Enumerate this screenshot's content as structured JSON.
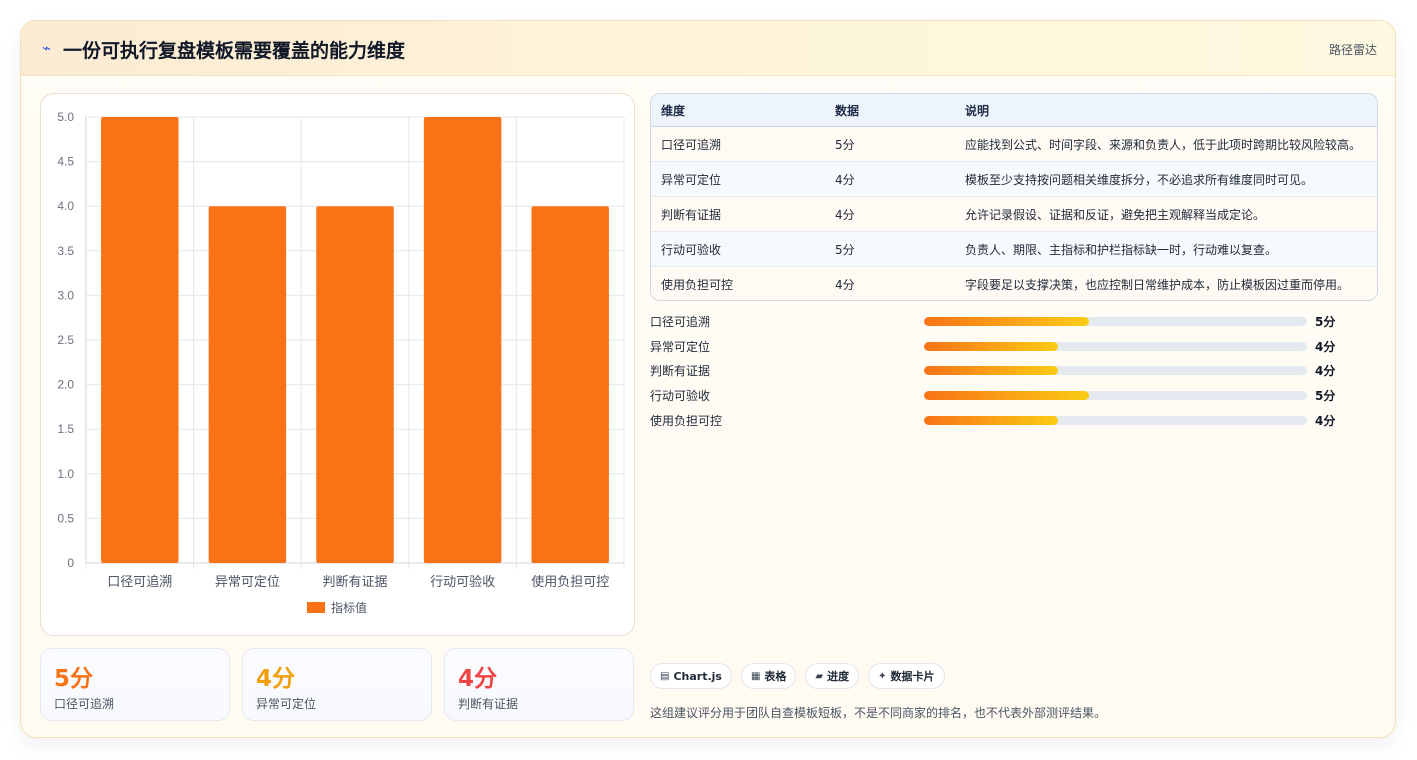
{
  "header": {
    "icon": "lightning-icon",
    "icon_glyph": "⌁",
    "title": "一份可执行复盘模板需要覆盖的能力维度",
    "tag": "路径雷达"
  },
  "chart_data": {
    "type": "bar",
    "categories": [
      "口径可追溯",
      "异常可定位",
      "判断有证据",
      "行动可验收",
      "使用负担可控"
    ],
    "series": [
      {
        "name": "指标值",
        "values": [
          5,
          4,
          4,
          5,
          4
        ],
        "color": "#f97316"
      }
    ],
    "yticks": [
      "0",
      "0.5",
      "1.0",
      "1.5",
      "2.0",
      "2.5",
      "3.0",
      "3.5",
      "4.0",
      "4.5",
      "5.0"
    ],
    "ylim": [
      0,
      5
    ],
    "grid": true,
    "legend": "bottom"
  },
  "stats": [
    {
      "value": "5分",
      "label": "口径可追溯",
      "color": "#f97316"
    },
    {
      "value": "4分",
      "label": "异常可定位",
      "color": "#f59e0b"
    },
    {
      "value": "4分",
      "label": "判断有证据",
      "color": "#ef4444"
    }
  ],
  "table": {
    "headers": [
      "维度",
      "数据",
      "说明"
    ],
    "rows": [
      [
        "口径可追溯",
        "5分",
        "应能找到公式、时间字段、来源和负责人，低于此项时跨期比较风险较高。"
      ],
      [
        "异常可定位",
        "4分",
        "模板至少支持按问题相关维度拆分，不必追求所有维度同时可见。"
      ],
      [
        "判断有证据",
        "4分",
        "允许记录假设、证据和反证，避免把主观解释当成定论。"
      ],
      [
        "行动可验收",
        "5分",
        "负责人、期限、主指标和护栏指标缺一时，行动难以复查。"
      ],
      [
        "使用负担可控",
        "4分",
        "字段要足以支撑决策，也应控制日常维护成本，防止模板因过重而停用。"
      ]
    ]
  },
  "progress": [
    {
      "label": "口径可追溯",
      "value": "5分",
      "fraction": 0.43
    },
    {
      "label": "异常可定位",
      "value": "4分",
      "fraction": 0.35
    },
    {
      "label": "判断有证据",
      "value": "4分",
      "fraction": 0.35
    },
    {
      "label": "行动可验收",
      "value": "5分",
      "fraction": 0.43
    },
    {
      "label": "使用负担可控",
      "value": "4分",
      "fraction": 0.35
    }
  ],
  "chips": [
    {
      "icon": "chart-icon",
      "glyph": "▤",
      "label": "Chart.js"
    },
    {
      "icon": "table-icon",
      "glyph": "▦",
      "label": "表格"
    },
    {
      "icon": "progress-icon",
      "glyph": "▰",
      "label": "进度"
    },
    {
      "icon": "sparkle-icon",
      "glyph": "✦",
      "label": "数据卡片"
    }
  ],
  "footnote": "这组建议评分用于团队自查模板短板，不是不同商家的排名，也不代表外部测评结果。"
}
